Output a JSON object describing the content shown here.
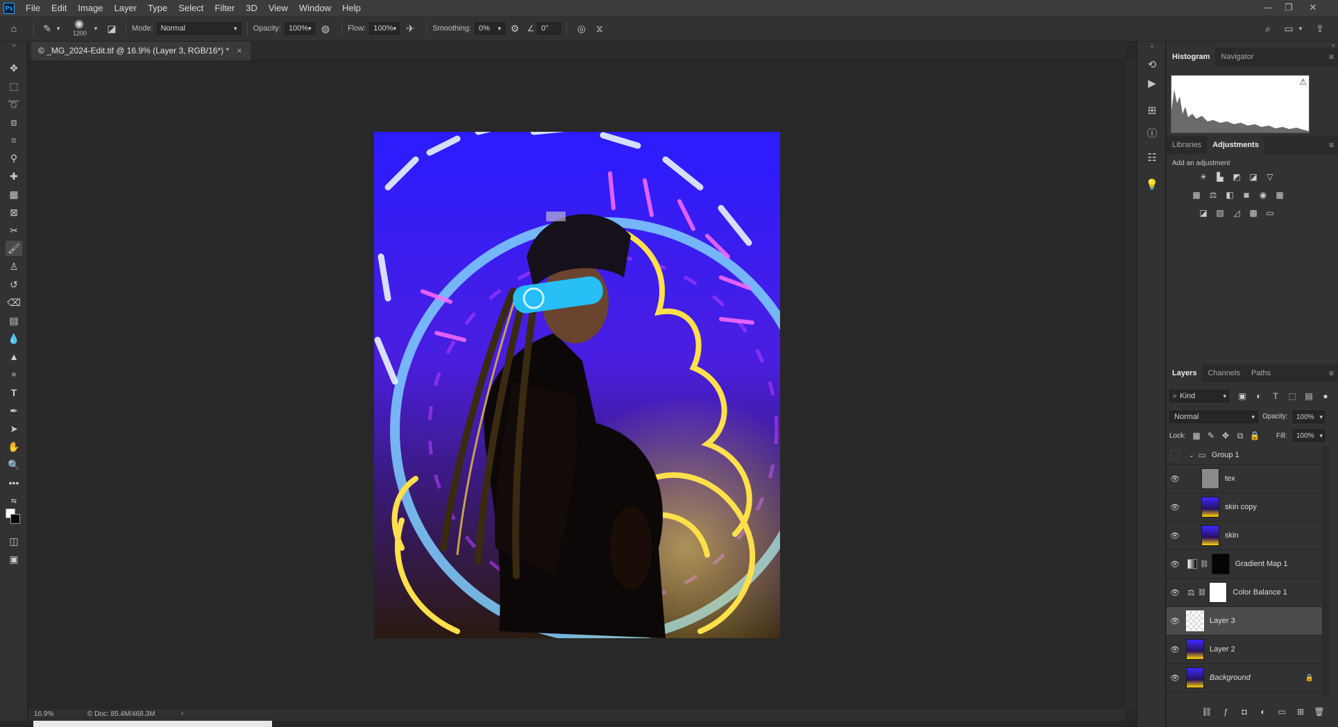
{
  "menubar": {
    "app_icon": "Ps",
    "items": [
      "File",
      "Edit",
      "Image",
      "Layer",
      "Type",
      "Select",
      "Filter",
      "3D",
      "View",
      "Window",
      "Help"
    ],
    "minimize": "—",
    "restore": "❐",
    "close": "✕"
  },
  "options": {
    "brush_size": "1200",
    "mode_label": "Mode:",
    "mode_value": "Normal",
    "opacity_label": "Opacity:",
    "opacity_value": "100%",
    "flow_label": "Flow:",
    "flow_value": "100%",
    "smoothing_label": "Smoothing:",
    "smoothing_value": "0%",
    "angle_value": "0°"
  },
  "document": {
    "tab_title": "© _MG_2024-Edit.tif @ 16.9% (Layer 3, RGB/16*) *",
    "tab_close": "×"
  },
  "status": {
    "zoom": "16.9%",
    "doc_info": "© Doc: 85.4M/468.3M",
    "arrow": "›"
  },
  "panels": {
    "top_tabs": [
      "Histogram",
      "Navigator"
    ],
    "mid_tabs": [
      "Libraries",
      "Adjustments"
    ],
    "add_adjustment": "Add an adjustment",
    "layers_tabs": [
      "Layers",
      "Channels",
      "Paths"
    ],
    "kind_label": "Kind",
    "blend_mode": "Normal",
    "opacity_label": "Opacity:",
    "opacity_value": "100%",
    "lock_label": "Lock:",
    "fill_label": "Fill:",
    "fill_value": "100%"
  },
  "layers": [
    {
      "name": "Group 1",
      "type": "group"
    },
    {
      "name": "tex",
      "type": "gray"
    },
    {
      "name": "skin copy",
      "type": "photo"
    },
    {
      "name": "skin",
      "type": "photo"
    },
    {
      "name": "Gradient Map 1",
      "type": "adjust"
    },
    {
      "name": "Color Balance 1",
      "type": "adjust"
    },
    {
      "name": "Layer 3",
      "type": "empty",
      "selected": true
    },
    {
      "name": "Layer 2",
      "type": "photo"
    },
    {
      "name": "Background",
      "type": "photo",
      "locked": true
    }
  ],
  "colors": {
    "accent": "#31a8ff",
    "neon_blue": "#3a2bff",
    "neon_yellow": "#ffd400"
  }
}
